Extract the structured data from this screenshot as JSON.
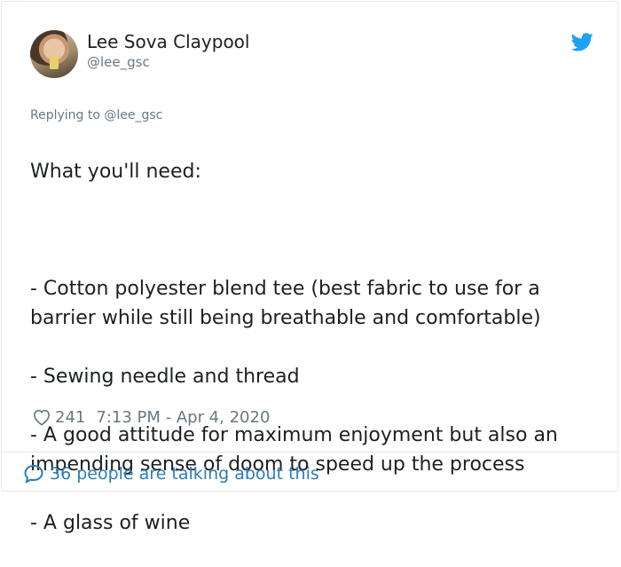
{
  "author": {
    "name": "Lee Sova Claypool",
    "handle": "@lee_gsc"
  },
  "icons": {
    "platform": "twitter-bird-icon",
    "like": "heart-icon",
    "conversation": "speech-bubble-icon"
  },
  "colors": {
    "brand": "#1da1f2",
    "link": "#2b7bb9",
    "muted": "#697882",
    "text": "#1c2022"
  },
  "reply_context": "Replying to @lee_gsc",
  "tweet": {
    "lines": [
      "What you'll need:",
      "",
      "- Cotton polyester blend tee (best fabric to use for a barrier while still being breathable and comfortable)",
      "- Sewing needle and thread",
      "- A good attitude for maximum enjoyment but also an impending sense of doom to speed up the process",
      "- A glass of wine"
    ]
  },
  "meta": {
    "likes": "241",
    "timestamp": "7:13 PM - Apr 4, 2020"
  },
  "conversation_link": "36 people are talking about this"
}
